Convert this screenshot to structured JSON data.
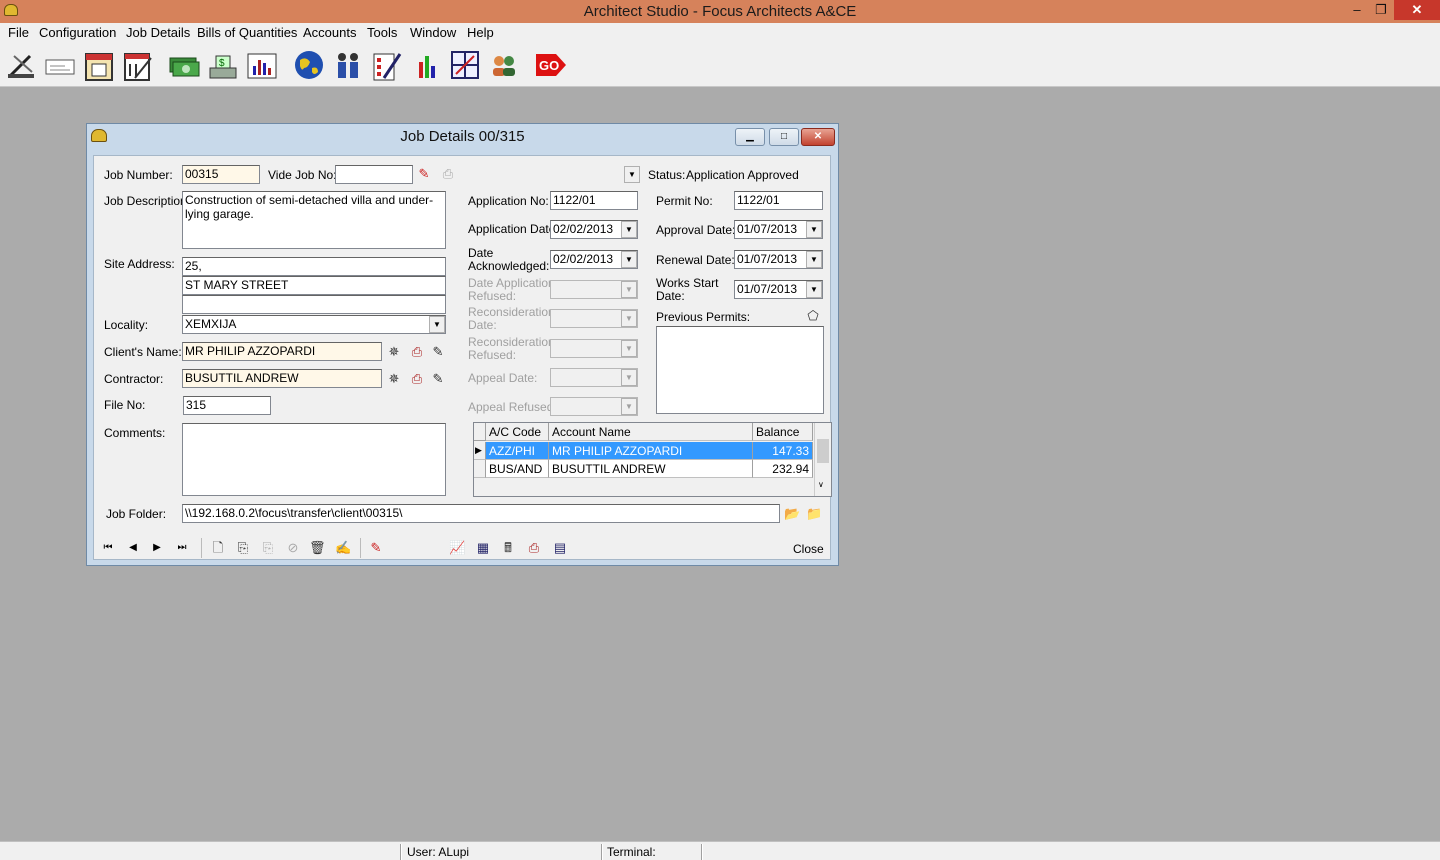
{
  "app": {
    "title": "Architect Studio - Focus Architects A&CE"
  },
  "menu": [
    "File",
    "Configuration",
    "Job Details",
    "Bills of Quantities",
    "Accounts",
    "Tools",
    "Window",
    "Help"
  ],
  "toolbar": [
    "draw-tool-icon",
    "cheque-icon",
    "calendar-icon",
    "bill-icon",
    "money-icon",
    "cash-register-icon",
    "bar-chart-icon",
    "globe-icon",
    "people-icon",
    "checklist-icon",
    "graph-icon",
    "blueprint-icon",
    "users-icon",
    "go-icon"
  ],
  "window": {
    "title": "Job Details 00/315",
    "labels": {
      "job_number": "Job Number:",
      "vide_job_no": "Vide Job No:",
      "job_description": "Job Description:",
      "site_address": "Site Address:",
      "locality": "Locality:",
      "clients_name": "Client's Name:",
      "contractor": "Contractor:",
      "file_no": "File No:",
      "comments": "Comments:",
      "job_folder": "Job Folder:",
      "status": "Status:",
      "application_no": "Application No:",
      "application_date": "Application Date:",
      "date_acknowledged_1": "Date",
      "date_acknowledged_2": "Acknowledged:",
      "date_app_refused_1": "Date Application",
      "date_app_refused_2": "Refused:",
      "recon_date_1": "Reconsideration",
      "recon_date_2": "Date:",
      "recon_refused_1": "Reconsideration",
      "recon_refused_2": "Refused:",
      "appeal_date": "Appeal Date:",
      "appeal_refused": "Appeal Refused:",
      "permit_no": "Permit No:",
      "approval_date": "Approval Date:",
      "renewal_date": "Renewal Date:",
      "works_start_1": "Works Start",
      "works_start_2": "Date:",
      "previous_permits": "Previous Permits:",
      "close": "Close"
    },
    "values": {
      "job_number": "00315",
      "vide_job_no": "",
      "job_description": "Construction of semi-detached villa and under-lying garage.",
      "site_address_1": "25,",
      "site_address_2": "ST MARY STREET",
      "site_address_3": "",
      "locality": "XEMXIJA",
      "clients_name": "MR PHILIP AZZOPARDI",
      "contractor": "BUSUTTIL ANDREW",
      "file_no": "315",
      "comments": "",
      "job_folder": "\\\\192.168.0.2\\focus\\transfer\\client\\00315\\",
      "status": "Application Approved",
      "application_no": "1122/01",
      "application_date": "02/02/2013",
      "date_acknowledged": "02/02/2013",
      "permit_no": "1122/01",
      "approval_date": "01/07/2013",
      "renewal_date": "01/07/2013",
      "works_start_date": "01/07/2013",
      "previous_permits": ""
    },
    "accounts": {
      "headers": [
        "A/C Code",
        "Account Name",
        "Balance"
      ],
      "rows": [
        {
          "code": "AZZ/PHI",
          "name": "MR PHILIP AZZOPARDI",
          "balance": "147.33"
        },
        {
          "code": "BUS/AND",
          "name": "BUSUTTIL ANDREW",
          "balance": "232.94"
        }
      ]
    }
  },
  "status_bar": {
    "user": "User: ALupi",
    "terminal": "Terminal:"
  }
}
